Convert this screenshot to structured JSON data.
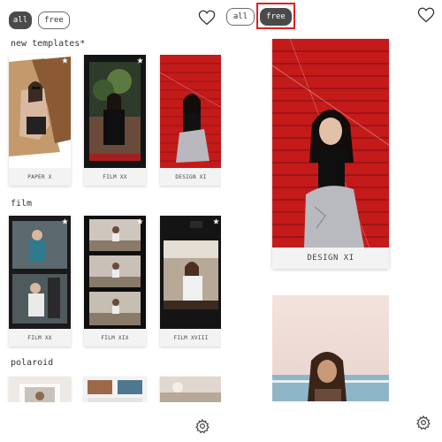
{
  "left": {
    "filters": {
      "all_label": "all",
      "free_label": "free",
      "active": "all"
    },
    "favorites_icon": "heart-icon",
    "sections": [
      {
        "title": "new templates*",
        "cards": [
          "PAPER X",
          "FILM XX",
          "DESIGN XI"
        ]
      },
      {
        "title": "film",
        "cards": [
          "FILM XX",
          "FILM XIX",
          "FILM XVIII"
        ]
      },
      {
        "title": "polaroid",
        "cards": []
      }
    ],
    "settings_icon": "gear-icon"
  },
  "right": {
    "filters": {
      "all_label": "all",
      "free_label": "free",
      "active": "free"
    },
    "favorites_icon": "heart-icon",
    "cards": [
      "DESIGN XI"
    ],
    "settings_icon": "gear-icon"
  },
  "colors": {
    "chip_active": "#4a4a4a",
    "highlight": "#e02020",
    "design_red": "#c41a1a"
  }
}
